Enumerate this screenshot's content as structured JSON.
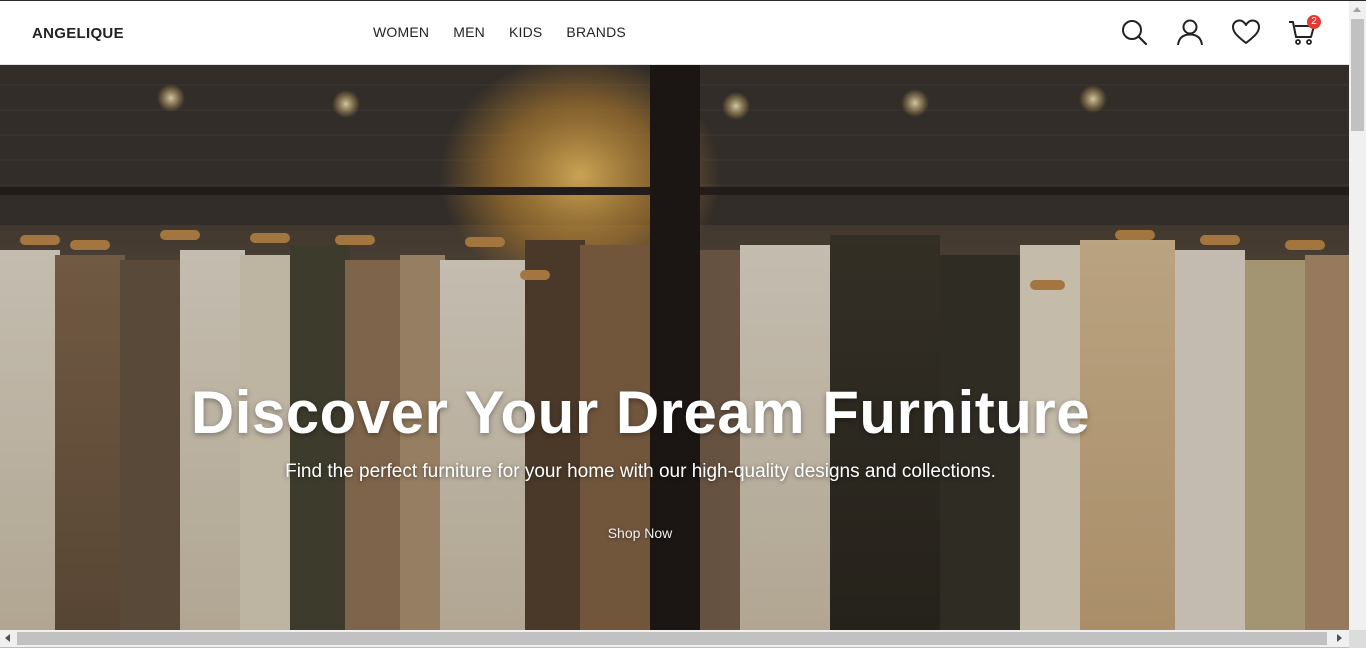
{
  "brand": {
    "name": "ANGELIQUE"
  },
  "nav": {
    "items": [
      "WOMEN",
      "MEN",
      "KIDS",
      "BRANDS"
    ]
  },
  "header_icons": {
    "search": "search-icon",
    "account": "user-icon",
    "wishlist": "heart-icon",
    "cart": "cart-icon",
    "cart_count": "2"
  },
  "hero": {
    "title": "Discover Your Dream Furniture",
    "subtitle": "Find the perfect furniture for your home with our high-quality designs and collections.",
    "cta_label": "Shop Now"
  },
  "colors": {
    "badge": "#e53935",
    "text_dark": "#222222",
    "hero_text": "#ffffff"
  }
}
